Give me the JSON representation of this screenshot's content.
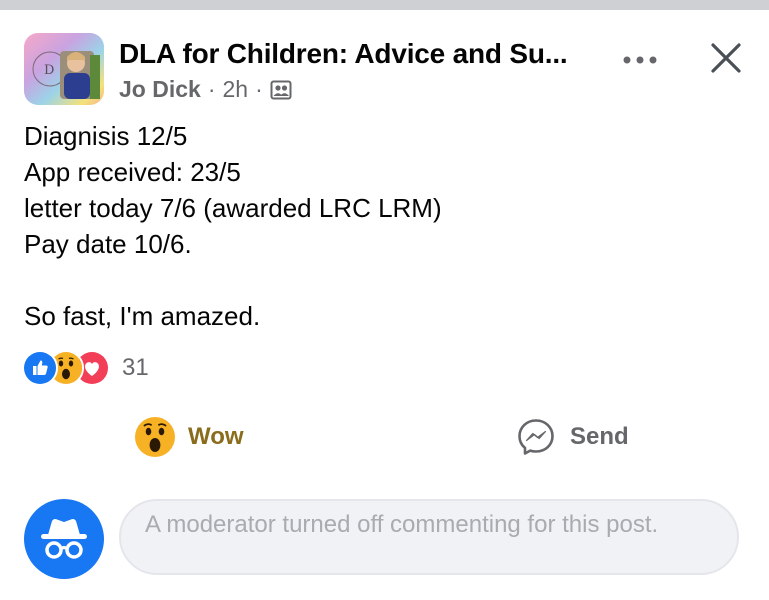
{
  "post": {
    "group_title": "DLA for Children: Advice and Su...",
    "author": "Jo Dick",
    "time": "2h",
    "separator": "·",
    "audience_icon": "group-icon",
    "body_lines": [
      "Diagnisis 12/5",
      "App received: 23/5",
      "letter today 7/6 (awarded LRC LRM)",
      "Pay date 10/6."
    ],
    "body_closing": "So fast, I'm amazed."
  },
  "reactions": {
    "types": [
      "like-icon",
      "wow-icon",
      "love-icon"
    ],
    "count": "31"
  },
  "actions": {
    "wow_label": "Wow",
    "send_label": "Send"
  },
  "comment": {
    "disabled_text": "A moderator turned off commenting for this post."
  },
  "colors": {
    "facebook_blue": "#1877f2",
    "secondary_text": "#65676b",
    "wow_label": "#8a6d1c",
    "love_red": "#f33e58",
    "wow_yellow": "#f7b125"
  }
}
